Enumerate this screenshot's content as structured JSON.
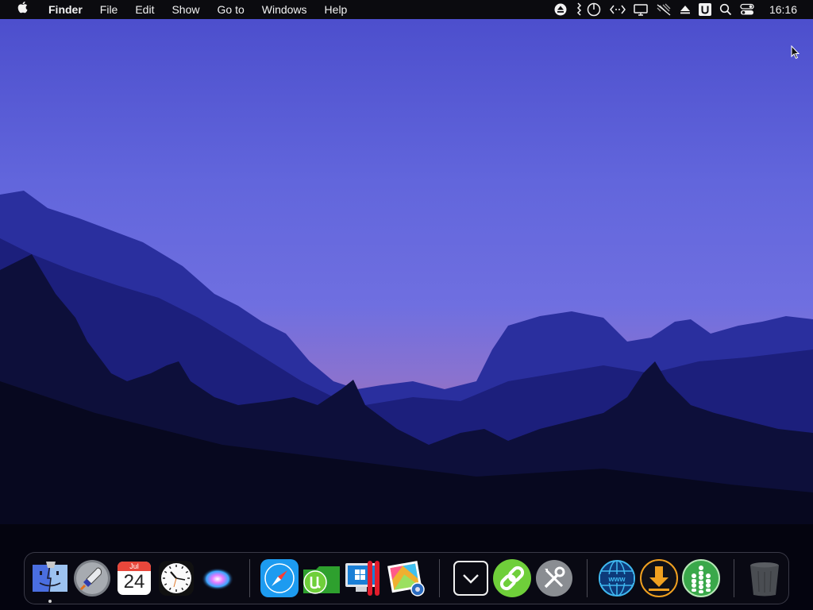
{
  "menubar": {
    "app_name": "Finder",
    "menus": [
      "File",
      "Edit",
      "Show",
      "Go to",
      "Windows",
      "Help"
    ],
    "clock": "16:16",
    "status_icons": [
      "eject-icon",
      "usb-power-icon",
      "code-brackets-icon",
      "display-icon",
      "wifi-off-icon",
      "upload-triangle-icon",
      "u-box-icon",
      "search-icon",
      "control-center-icon"
    ]
  },
  "dock": {
    "items": [
      {
        "name": "finder-icon",
        "running": true
      },
      {
        "name": "launchpad-rocket-icon"
      },
      {
        "name": "calendar-icon",
        "month": "Jul",
        "day": "24"
      },
      {
        "name": "clock-icon"
      },
      {
        "name": "siri-icon"
      },
      {
        "name": "safari-compass-icon"
      },
      {
        "name": "utorrent-icon"
      },
      {
        "name": "parallels-windows-icon"
      },
      {
        "name": "photo-viewer-icon"
      },
      {
        "name": "downloads-chevron-icon"
      },
      {
        "name": "link-chain-icon"
      },
      {
        "name": "system-tools-icon"
      },
      {
        "name": "www-globe-icon"
      },
      {
        "name": "download-arrow-icon"
      },
      {
        "name": "people-network-icon"
      },
      {
        "name": "trash-icon"
      }
    ]
  },
  "colors": {
    "sky_top": "#4b4fd0",
    "sky_mid": "#6b6fe0",
    "horizon": "#8e70c8",
    "menubar_bg": "#0b0b0f"
  }
}
